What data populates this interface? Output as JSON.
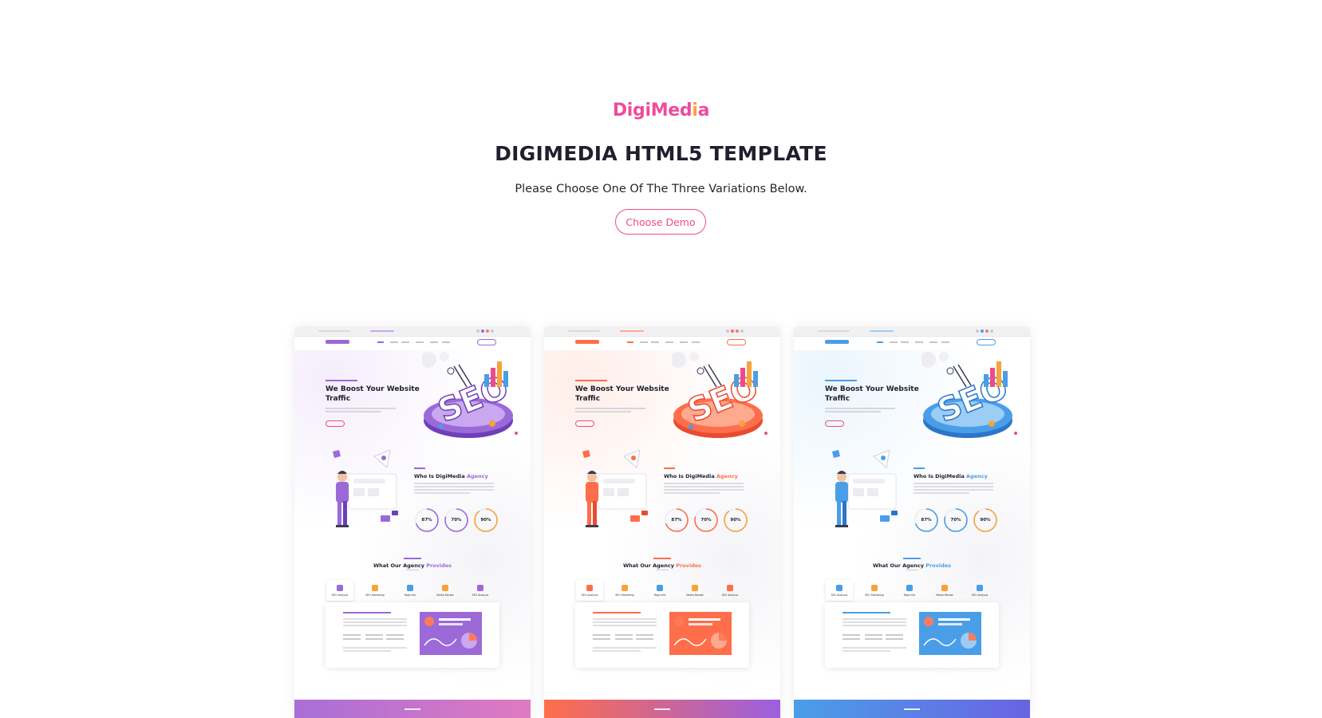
{
  "brand": {
    "logo_part1": "DigiMed",
    "logo_part2": "i",
    "logo_part3": "a"
  },
  "header": {
    "title": "DIGIMEDIA HTML5 TEMPLATE",
    "subtitle": "Please Choose One Of The Three Variations Below.",
    "button_label": "Choose Demo"
  },
  "colors": {
    "accent_pink": "#ef4a8b",
    "logo_orange": "#f7a23b",
    "variant_purple": "#9b6ad8",
    "variant_red": "#ff6e4a",
    "variant_blue": "#4a9ee8"
  },
  "demos": [
    {
      "variant": "purple",
      "hero_heading_line1": "We Boost Your Website",
      "hero_heading_line2": "Traffic",
      "about_title_prefix": "Who Is DigiMedia ",
      "about_title_accent": "Agency",
      "stats": [
        "87%",
        "70%",
        "90%"
      ],
      "provides_prefix": "What Our Agency ",
      "provides_accent": "Provides",
      "services": [
        "SEO Analysis",
        "SEO Marketing",
        "Page Info",
        "Media Market",
        "SEO Analysis"
      ]
    },
    {
      "variant": "red",
      "hero_heading_line1": "We Boost Your Website",
      "hero_heading_line2": "Traffic",
      "about_title_prefix": "Who Is DigiMedia ",
      "about_title_accent": "Agency",
      "stats": [
        "87%",
        "70%",
        "90%"
      ],
      "provides_prefix": "What Our Agency ",
      "provides_accent": "Provides",
      "services": [
        "SEO Analysis",
        "SEO Marketing",
        "Page Info",
        "Media Market",
        "SEO Analysis"
      ]
    },
    {
      "variant": "blue",
      "hero_heading_line1": "We Boost Your Website",
      "hero_heading_line2": "Traffic",
      "about_title_prefix": "Who Is DigiMedia ",
      "about_title_accent": "Agency",
      "stats": [
        "87%",
        "70%",
        "90%"
      ],
      "provides_prefix": "What Our Agency ",
      "provides_accent": "Provides",
      "services": [
        "SEO Analysis",
        "SEO Marketing",
        "Page Info",
        "Media Market",
        "SEO Analysis"
      ]
    }
  ]
}
